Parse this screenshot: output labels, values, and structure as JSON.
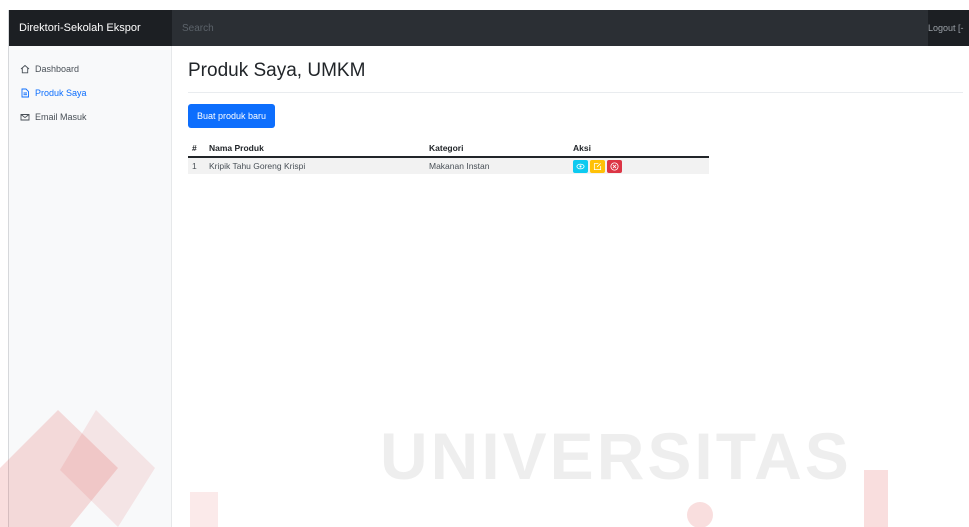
{
  "navbar": {
    "brand": "Direktori-Sekolah Ekspor",
    "search_placeholder": "Search",
    "logout": "Logout [-"
  },
  "sidebar": {
    "items": [
      {
        "label": "Dashboard",
        "icon": "home-icon",
        "active": false
      },
      {
        "label": "Produk Saya",
        "icon": "file-icon",
        "active": true
      },
      {
        "label": "Email Masuk",
        "icon": "mail-icon",
        "active": false
      }
    ]
  },
  "main": {
    "title": "Produk Saya, UMKM",
    "new_button": "Buat produk baru",
    "table": {
      "headers": [
        "#",
        "Nama Produk",
        "Kategori",
        "Aksi"
      ],
      "rows": [
        {
          "no": "1",
          "name": "Kripik Tahu Goreng Krispi",
          "category": "Makanan Instan"
        }
      ]
    }
  },
  "watermark": {
    "text": "UNIVERSITAS"
  },
  "colors": {
    "navbar": "#212529",
    "primary": "#0d6efd",
    "view": "#0dcaf0",
    "edit": "#ffc107",
    "delete": "#dc3545",
    "watermark_red": "#d9322f"
  }
}
